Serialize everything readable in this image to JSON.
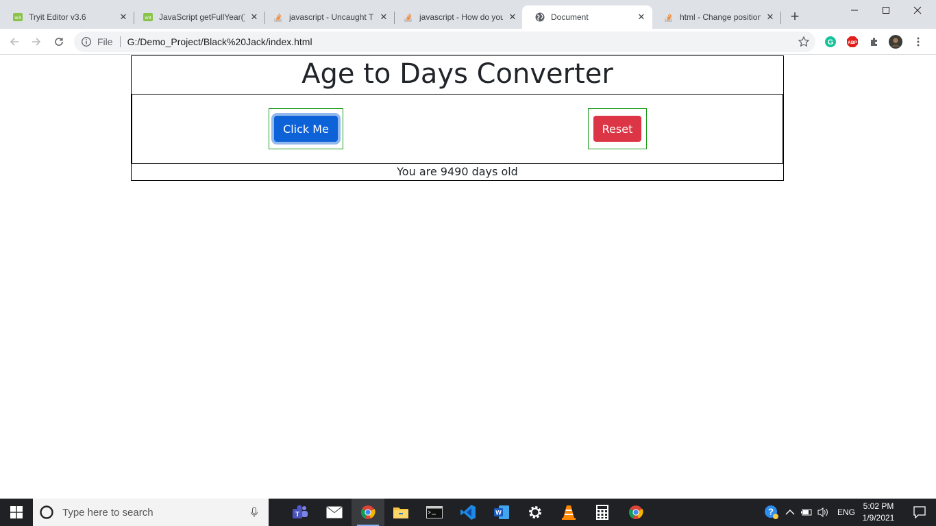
{
  "browser": {
    "tabs": [
      {
        "title": "Tryit Editor v3.6",
        "icon": "w3schools-icon"
      },
      {
        "title": "JavaScript getFullYear()",
        "icon": "w3schools-icon"
      },
      {
        "title": "javascript - Uncaught T",
        "icon": "stackoverflow-icon"
      },
      {
        "title": "javascript - How do you",
        "icon": "stackoverflow-icon"
      },
      {
        "title": "Document",
        "icon": "globe-icon",
        "active": true
      },
      {
        "title": "html - Change position",
        "icon": "stackoverflow-icon"
      }
    ],
    "close_glyph": "✕",
    "new_tab_glyph": "+",
    "address": {
      "scheme": "File",
      "url": "G:/Demo_Project/Black%20Jack/index.html"
    },
    "extensions": [
      "grammarly-icon",
      "adblock-plus-icon",
      "puzzle-icon",
      "profile-avatar"
    ],
    "abp_label": "ABP",
    "grammarly_label": "G"
  },
  "page": {
    "heading": "Age to Days Converter",
    "click_button": "Click Me",
    "reset_button": "Reset",
    "result": "You are 9490 days old"
  },
  "taskbar": {
    "search_placeholder": "Type here to search",
    "language": "ENG",
    "time": "5:02 PM",
    "date": "1/9/2021",
    "apps": [
      "teams-icon",
      "mail-icon",
      "chrome-icon",
      "file-explorer-icon",
      "terminal-icon",
      "vscode-icon",
      "word-icon",
      "settings-icon",
      "vlc-icon",
      "calculator-icon",
      "chrome-icon"
    ]
  },
  "colors": {
    "primary": "#0d62d8",
    "danger": "#dc3545",
    "box_border": "#1f9c1f"
  }
}
